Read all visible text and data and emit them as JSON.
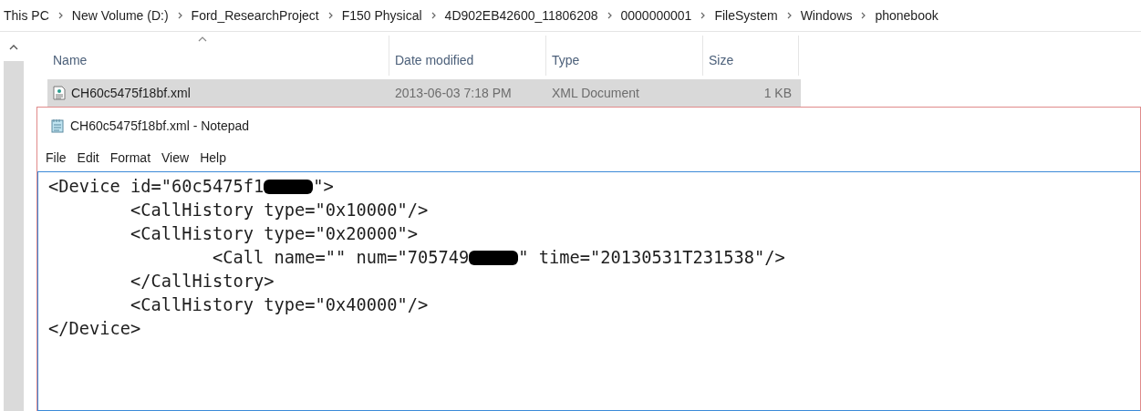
{
  "breadcrumb": [
    "This PC",
    "New Volume (D:)",
    "Ford_ResearchProject",
    "F150 Physical",
    "4D902EB42600_11806208",
    "0000000001",
    "FileSystem",
    "Windows",
    "phonebook"
  ],
  "columns": [
    {
      "label": "Name",
      "sorted": true
    },
    {
      "label": "Date modified",
      "sorted": false
    },
    {
      "label": "Type",
      "sorted": false
    },
    {
      "label": "Size",
      "sorted": false
    }
  ],
  "files": [
    {
      "name": "CH60c5475f18bf.xml",
      "date_modified": "2013-06-03 7:18 PM",
      "type": "XML Document",
      "size": "1 KB",
      "selected": true
    }
  ],
  "notepad": {
    "title": "CH60c5475f18bf.xml - Notepad",
    "menu": [
      "File",
      "Edit",
      "Format",
      "View",
      "Help"
    ],
    "lines": [
      [
        {
          "kind": "text",
          "text": "<Device id=\"60c5475f1"
        },
        {
          "kind": "redaction"
        },
        {
          "kind": "text",
          "text": "\">"
        }
      ],
      [
        {
          "kind": "text",
          "text": "\t<CallHistory type=\"0x10000\"/>"
        }
      ],
      [
        {
          "kind": "text",
          "text": "\t<CallHistory type=\"0x20000\">"
        }
      ],
      [
        {
          "kind": "text",
          "text": "\t\t<Call name=\"\" num=\"705749"
        },
        {
          "kind": "redaction"
        },
        {
          "kind": "text",
          "text": "\" time=\"20130531T231538\"/>"
        }
      ],
      [
        {
          "kind": "text",
          "text": "\t</CallHistory>"
        }
      ],
      [
        {
          "kind": "text",
          "text": "\t<CallHistory type=\"0x40000\"/>"
        }
      ],
      [
        {
          "kind": "text",
          "text": "</Device>"
        }
      ]
    ]
  }
}
